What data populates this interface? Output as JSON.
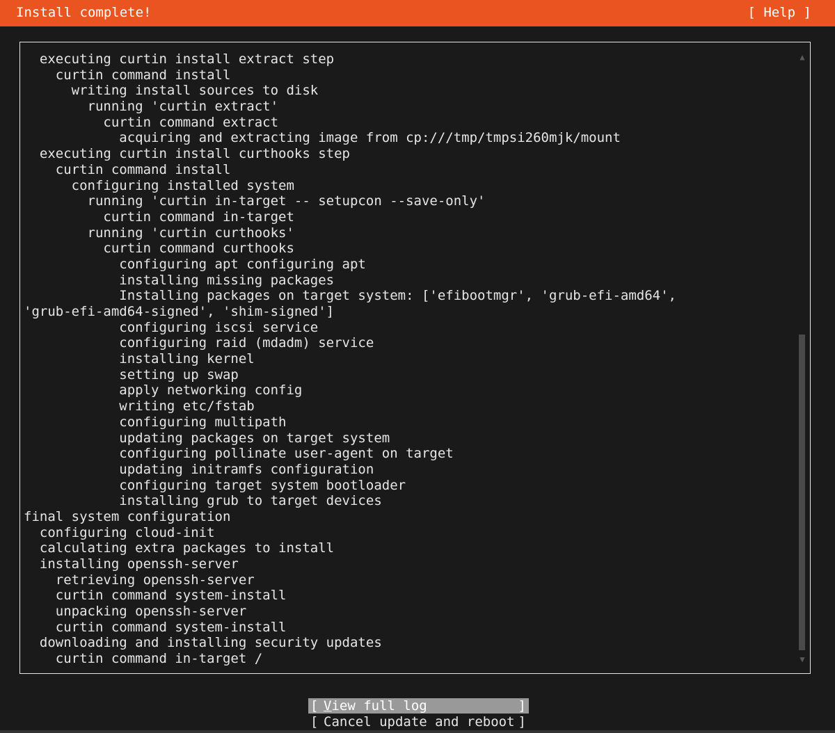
{
  "header": {
    "title": "Install complete!",
    "help_label": "[ Help ]"
  },
  "log": {
    "lines": [
      "  executing curtin install extract step",
      "    curtin command install",
      "      writing install sources to disk",
      "        running 'curtin extract'",
      "          curtin command extract",
      "            acquiring and extracting image from cp:///tmp/tmpsi260mjk/mount",
      "  executing curtin install curthooks step",
      "    curtin command install",
      "      configuring installed system",
      "        running 'curtin in-target -- setupcon --save-only'",
      "          curtin command in-target",
      "        running 'curtin curthooks'",
      "          curtin command curthooks",
      "            configuring apt configuring apt",
      "            installing missing packages",
      "            Installing packages on target system: ['efibootmgr', 'grub-efi-amd64',",
      "'grub-efi-amd64-signed', 'shim-signed']",
      "            configuring iscsi service",
      "            configuring raid (mdadm) service",
      "            installing kernel",
      "            setting up swap",
      "            apply networking config",
      "            writing etc/fstab",
      "            configuring multipath",
      "            updating packages on target system",
      "            configuring pollinate user-agent on target",
      "            updating initramfs configuration",
      "            configuring target system bootloader",
      "            installing grub to target devices",
      "final system configuration",
      "  configuring cloud-init",
      "  calculating extra packages to install",
      "  installing openssh-server",
      "    retrieving openssh-server",
      "    curtin command system-install",
      "    unpacking openssh-server",
      "    curtin command system-install",
      "  downloading and installing security updates",
      "    curtin command in-target /"
    ],
    "scroll_up_glyph": "▲",
    "scroll_down_glyph": "▼"
  },
  "buttons": {
    "view_log": {
      "left": "[",
      "first": "V",
      "rest": "iew full log",
      "right": "]"
    },
    "cancel": {
      "left": "[",
      "first": "",
      "rest": "Cancel update and reboot",
      "right": "]"
    }
  },
  "colors": {
    "header_bg": "#e95420",
    "background": "#1a1a1a",
    "text": "#e6e6e6",
    "focused_button_bg": "#999999"
  }
}
